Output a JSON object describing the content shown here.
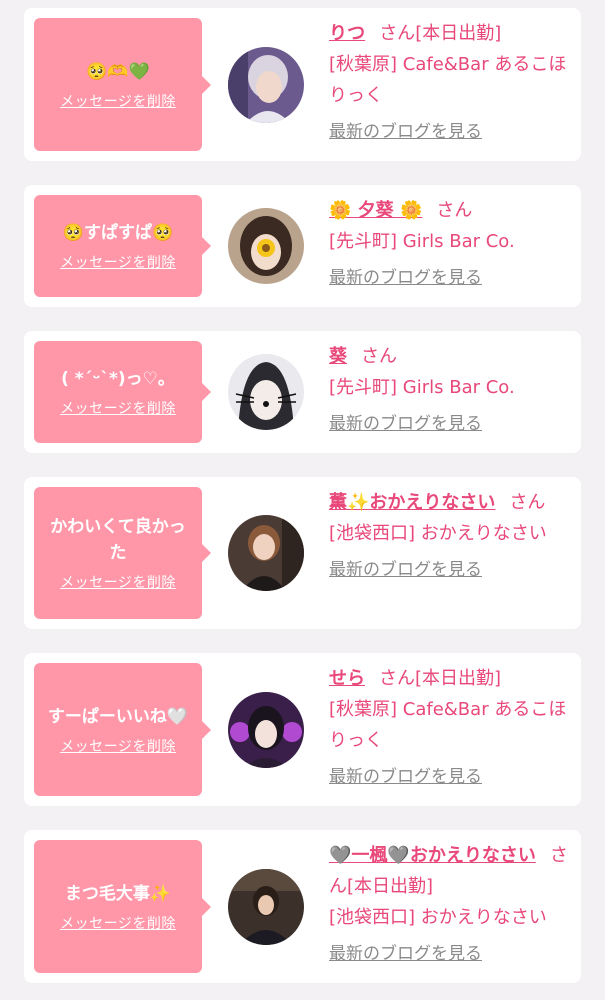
{
  "items": [
    {
      "message": "🥺🫶💚",
      "delete_label": "メッセージを削除",
      "name": "りつ",
      "honorific": "さん",
      "status": "[本日出勤]",
      "shop": "[秋葉原] Cafe&Bar あるこほりっく",
      "blog_label": "最新のブログを見る",
      "avatar_icon": "avatar-photo"
    },
    {
      "message": "🥺すぱすぱ🥺",
      "delete_label": "メッセージを削除",
      "name": "🌼 夕葵 🌼",
      "honorific": "さん",
      "status": "",
      "shop": "[先斗町] Girls Bar Co.",
      "blog_label": "最新のブログを見る",
      "avatar_icon": "avatar-photo"
    },
    {
      "message": "( *ˊᵕˋ*)っ♡。",
      "delete_label": "メッセージを削除",
      "name": "葵",
      "honorific": "さん",
      "status": "",
      "shop": "[先斗町] Girls Bar Co.",
      "blog_label": "最新のブログを見る",
      "avatar_icon": "avatar-photo"
    },
    {
      "message": "かわいくて良かった",
      "delete_label": "メッセージを削除",
      "name": "薫✨おかえりなさい",
      "honorific": "さん",
      "status": "",
      "shop": "[池袋西口] おかえりなさい",
      "blog_label": "最新のブログを見る",
      "avatar_icon": "avatar-photo"
    },
    {
      "message": "すーぱーいいね🤍",
      "delete_label": "メッセージを削除",
      "name": "せら",
      "honorific": "さん",
      "status": "[本日出勤]",
      "shop": "[秋葉原] Cafe&Bar あるこほりっく",
      "blog_label": "最新のブログを見る",
      "avatar_icon": "avatar-photo"
    },
    {
      "message": "まつ毛大事✨",
      "delete_label": "メッセージを削除",
      "name": "🩶一楓🩶おかえりなさい",
      "honorific": "さん",
      "status": "[本日出勤]",
      "shop": "[池袋西口] おかえりなさい",
      "blog_label": "最新のブログを見る",
      "avatar_icon": "avatar-photo"
    }
  ],
  "colors": {
    "accent": "#e8487a",
    "bubble": "#ff97a9",
    "card": "#ffffff",
    "background": "#f3f1f3",
    "link_gray": "#8a8a8a"
  }
}
